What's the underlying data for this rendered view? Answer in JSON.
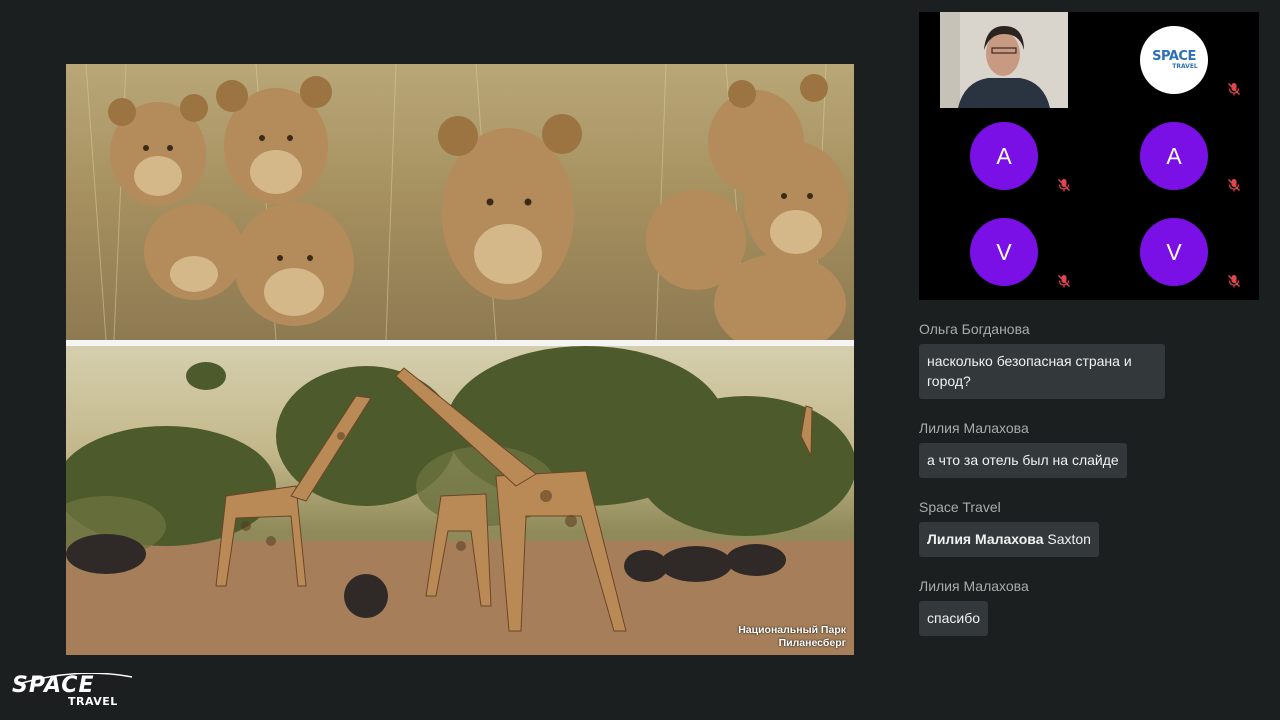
{
  "slide": {
    "caption_line1": "Национальный Парк",
    "caption_line2": "Пиланесберг"
  },
  "brand": {
    "word": "SPACE",
    "sub": "TRAVEL"
  },
  "video_grid": {
    "badge_word": "SPACE",
    "badge_sub": "TRAVEL",
    "participants": [
      {
        "initial": "A"
      },
      {
        "initial": "A"
      },
      {
        "initial": "V"
      },
      {
        "initial": "V"
      }
    ],
    "accent_color": "#7b10e6",
    "muted_color": "#e0444e"
  },
  "chat": {
    "messages": [
      {
        "sender": "Ольга Богданова",
        "text": "насколько безопасная страна и город?"
      },
      {
        "sender": "Лилия Малахова",
        "text": "а что за отель был на слайде"
      },
      {
        "sender": "Space Travel",
        "mention": "Лилия Малахова",
        "text": " Saxton"
      },
      {
        "sender": "Лилия Малахова",
        "text": "спасибо"
      }
    ]
  }
}
